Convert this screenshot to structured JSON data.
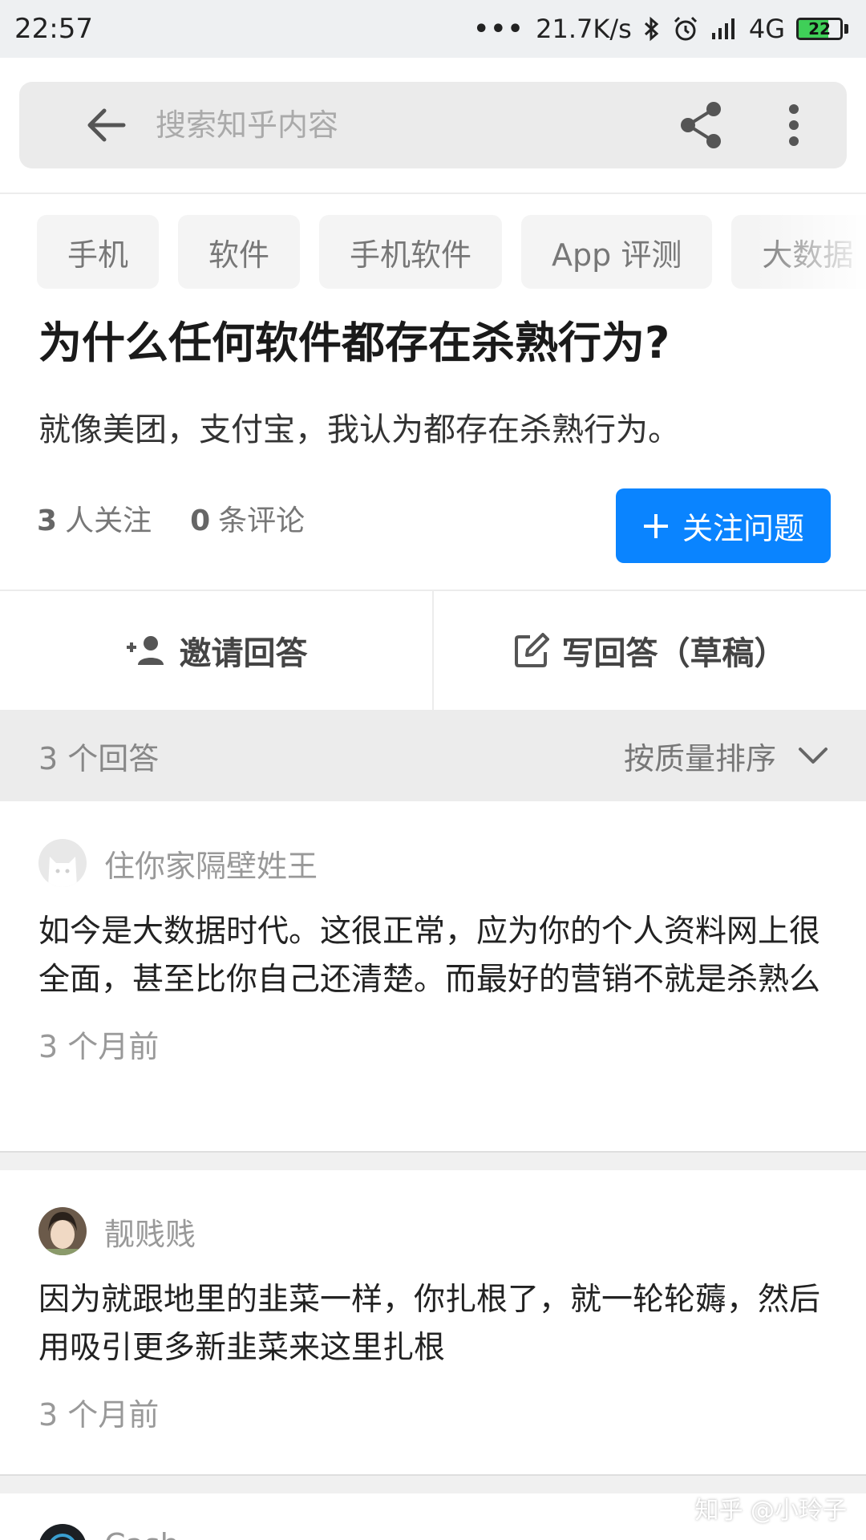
{
  "status_bar": {
    "time": "22:57",
    "dots": "•••",
    "network_speed": "21.7K/s",
    "network": "4G",
    "battery": "22",
    "battery_level": 0.22,
    "icons": [
      "bluetooth-icon",
      "alarm-icon",
      "signal-icon"
    ]
  },
  "search": {
    "placeholder": "搜索知乎内容"
  },
  "tags": [
    "手机",
    "软件",
    "手机软件",
    "App 评测",
    "大数据"
  ],
  "question": {
    "title": "为什么任何软件都存在杀熟行为?",
    "detail": "就像美团，支付宝，我认为都存在杀熟行为。",
    "followers_count": "3",
    "followers_label": "人关注",
    "comments_count": "0",
    "comments_label": "条评论",
    "follow_button": "关注问题"
  },
  "actions": {
    "invite": "邀请回答",
    "write": "写回答（草稿）"
  },
  "sort_bar": {
    "count": "3 个回答",
    "sort_label": "按质量排序"
  },
  "answers": [
    {
      "author": "住你家隔壁姓王",
      "content": "如今是大数据时代。这很正常，应为你的个人资料网上很全面，甚至比你自己还清楚。而最好的营销不就是杀熟么",
      "time": "3 个月前"
    },
    {
      "author": "靓贱贱",
      "content": "因为就跟地里的韭菜一样，你扎根了，就一轮轮薅，然后用吸引更多新韭菜来这里扎根",
      "time": "3 个月前"
    },
    {
      "author": "Cash"
    }
  ],
  "watermark": "知乎 @小玲子",
  "colors": {
    "accent": "#0a84ff",
    "sort_bar_bg": "#ececec"
  }
}
